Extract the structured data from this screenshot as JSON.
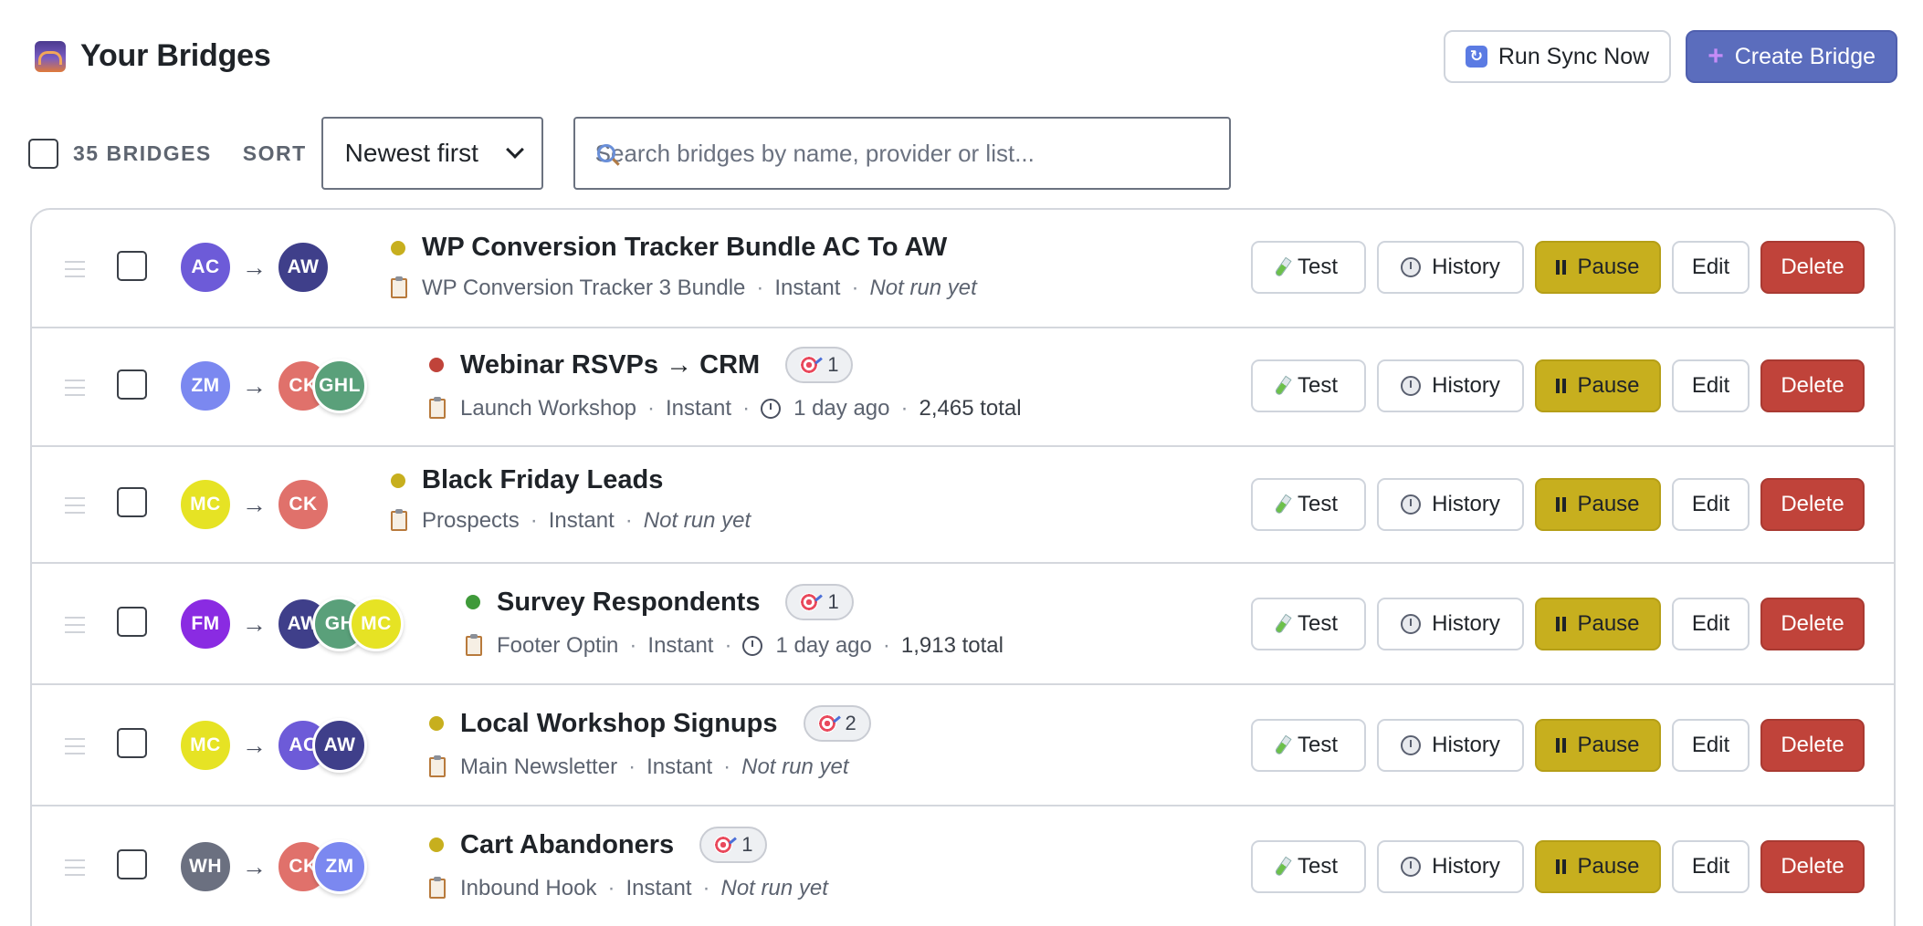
{
  "header": {
    "title": "Your Bridges",
    "logo_icon": "bridge-icon"
  },
  "top_actions": {
    "sync_label": "Run Sync Now",
    "create_label": "Create Bridge"
  },
  "toolbar": {
    "count_label": "35 BRIDGES",
    "sort_label": "SORT",
    "sort_selected": "Newest first",
    "search_placeholder": "Search bridges by name, provider or list..."
  },
  "colors": {
    "primary": "#5b6dbd",
    "pause": "#c7af1e",
    "delete": "#c0433a",
    "status_yellow": "#c7af1e",
    "status_red": "#c0433a",
    "status_green": "#3f9a3a"
  },
  "action_labels": {
    "test": "Test",
    "history": "History",
    "pause": "Pause",
    "edit": "Edit",
    "delete": "Delete"
  },
  "bridges": [
    {
      "source": {
        "initials": "AC",
        "color": "#6d5bd8"
      },
      "destinations": [
        {
          "initials": "AW",
          "color": "#3f3f8a"
        }
      ],
      "status": "yellow",
      "title": "WP Conversion Tracker Bundle AC To AW",
      "badge": null,
      "list": "WP Conversion Tracker 3 Bundle",
      "mode": "Instant",
      "last_run": "Not run yet",
      "total": null
    },
    {
      "source": {
        "initials": "ZM",
        "color": "#7b88f0"
      },
      "destinations": [
        {
          "initials": "CK",
          "color": "#e0716b"
        },
        {
          "initials": "GHL",
          "color": "#5aa07a"
        }
      ],
      "status": "red",
      "title": "Webinar RSVPs → CRM",
      "badge": "1",
      "list": "Launch Workshop",
      "mode": "Instant",
      "last_run": "1 day ago",
      "total": "2,465 total"
    },
    {
      "source": {
        "initials": "MC",
        "color": "#e6e324"
      },
      "destinations": [
        {
          "initials": "CK",
          "color": "#e0716b"
        }
      ],
      "status": "yellow",
      "title": "Black Friday Leads",
      "badge": null,
      "list": "Prospects",
      "mode": "Instant",
      "last_run": "Not run yet",
      "total": null
    },
    {
      "source": {
        "initials": "FM",
        "color": "#8a2be2"
      },
      "destinations": [
        {
          "initials": "AW",
          "color": "#3f3f8a"
        },
        {
          "initials": "GH",
          "color": "#5aa07a"
        },
        {
          "initials": "MC",
          "color": "#e6e324"
        }
      ],
      "status": "green",
      "title": "Survey Respondents",
      "badge": "1",
      "list": "Footer Optin",
      "mode": "Instant",
      "last_run": "1 day ago",
      "total": "1,913 total"
    },
    {
      "source": {
        "initials": "MC",
        "color": "#e6e324"
      },
      "destinations": [
        {
          "initials": "AC",
          "color": "#6d5bd8"
        },
        {
          "initials": "AW",
          "color": "#3f3f8a"
        }
      ],
      "status": "yellow",
      "title": "Local Workshop Signups",
      "badge": "2",
      "list": "Main Newsletter",
      "mode": "Instant",
      "last_run": "Not run yet",
      "total": null
    },
    {
      "source": {
        "initials": "WH",
        "color": "#6b7080"
      },
      "destinations": [
        {
          "initials": "CK",
          "color": "#e0716b"
        },
        {
          "initials": "ZM",
          "color": "#7b88f0"
        }
      ],
      "status": "yellow",
      "title": "Cart Abandoners",
      "badge": "1",
      "list": "Inbound Hook",
      "mode": "Instant",
      "last_run": "Not run yet",
      "total": null
    }
  ]
}
